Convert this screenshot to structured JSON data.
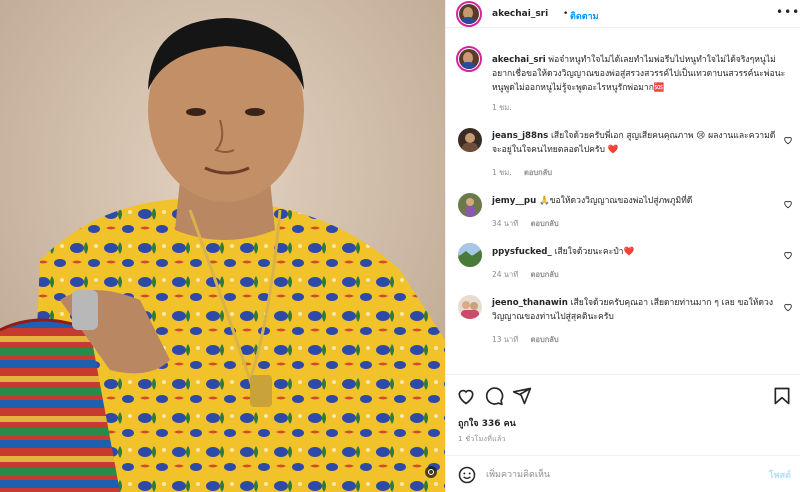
{
  "header": {
    "username": "akechai_sri",
    "separator": "•",
    "follow_label": "ติดตาม",
    "more_label": "•••"
  },
  "caption": {
    "username": "akechai_sri",
    "text": "พ่อจ๋าหนูทำใจไม่ได้เลยทำไมพ่อรีบไปหนูทำใจไม่ได้จริงๆหนูไม่อยากเชื่อขอให้ดวงวิญญาณของพ่อสู่สรวงสวรรค์ไปเป็นเทวดาบนสวรรค์นะพ่อนะหนูพูดไม่ออกหนูไม่รู้จะพูดอะไรหนูรักพ่อมาก🆘",
    "time": "1 ชม."
  },
  "comments": [
    {
      "username": "jeans_j88ns",
      "text": "เสียใจด้วยครับพี่เอก สูญเสียคนคุณภาพ 😢 ผลงานและความดีจะอยู่ในใจคนไทยตลอดไปครับ ❤️",
      "time": "1 ชม.",
      "reply_label": "ตอบกลับ"
    },
    {
      "username": "jemy__pu",
      "text": "🙏ขอให้ดวงวิญญาณของพ่อไปสู่ภพภูมิที่ดี",
      "time": "34 นาที",
      "reply_label": "ตอบกลับ"
    },
    {
      "username": "ppysfucked_",
      "text": "เสียใจด้วยนะคะป๋า❤️",
      "time": "24 นาที",
      "reply_label": "ตอบกลับ"
    },
    {
      "username": "jeeno_thanawin",
      "text": "เสียใจด้วยครับคุณอา เสียดายท่านมาก ๆ เลย ขอให้ดวงวิญญาณของท่านไปสู่สุคตินะครับ",
      "time": "13 นาที",
      "reply_label": "ตอบกลับ"
    }
  ],
  "actions": {
    "likes": "ถูกใจ 336 คน",
    "posted_ago": "1 ชั่วโมงที่แล้ว"
  },
  "add_comment": {
    "placeholder": "เพิ่มความคิดเห็น",
    "post_label": "โพสต์"
  },
  "icons": {
    "like": "heart-icon",
    "comment": "comment-icon",
    "share": "paper-plane-icon",
    "save": "bookmark-icon",
    "emoji": "smiley-icon",
    "more": "more-icon"
  },
  "colors": {
    "link_blue": "#0095f6",
    "post_disabled": "#b2dffc",
    "heart_red": "#ed4956",
    "muted": "#8e8e8e",
    "border": "#efefef"
  }
}
